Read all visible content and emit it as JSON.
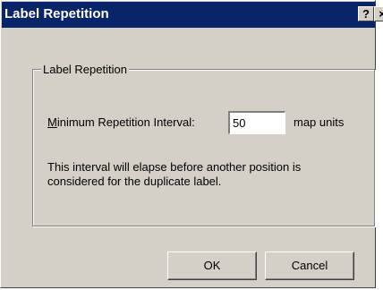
{
  "window": {
    "title": "Label Repetition",
    "help_button": "?",
    "close_button": "×"
  },
  "group": {
    "legend": "Label Repetition",
    "min_interval_mnemonic": "M",
    "min_interval_label_rest": "inimum Repetition Interval:",
    "interval_value": "50",
    "units_label": "map units",
    "description": "This interval will elapse before another position is considered for the duplicate label."
  },
  "buttons": {
    "ok": "OK",
    "cancel": "Cancel"
  },
  "colors": {
    "titlebar": "#0a246a",
    "dialog_face": "#d4d0c8"
  }
}
